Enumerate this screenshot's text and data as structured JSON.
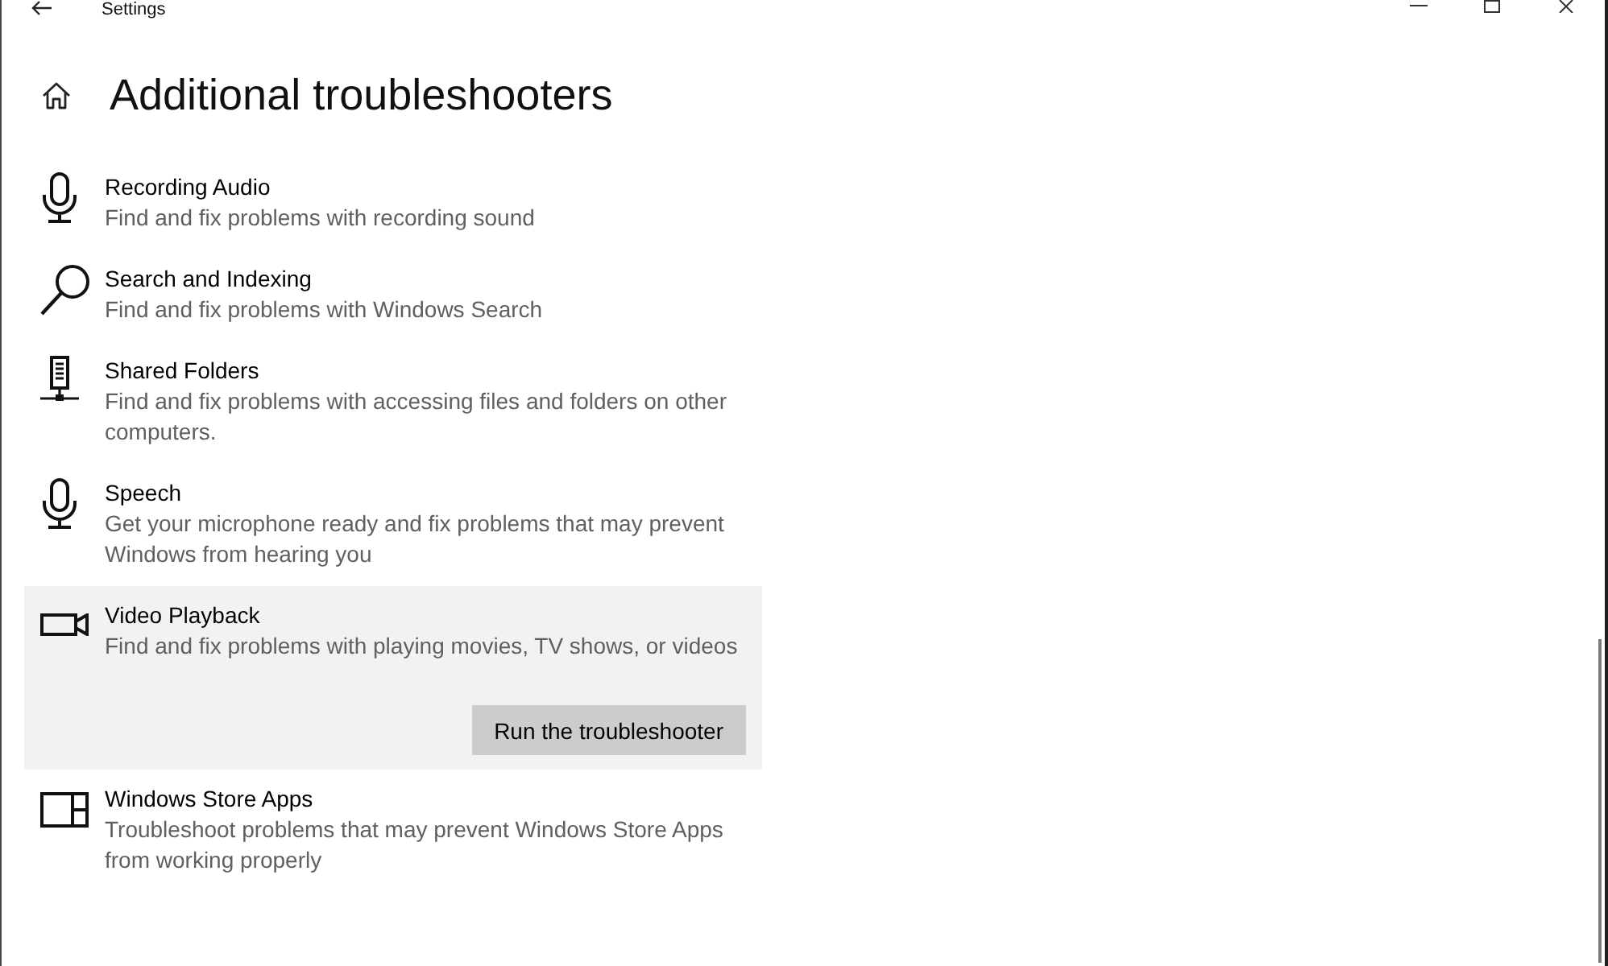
{
  "window": {
    "title": "Settings"
  },
  "page": {
    "title": "Additional troubleshooters"
  },
  "troubleshooters": [
    {
      "kind": "microphone",
      "title": "Recording Audio",
      "description": "Find and fix problems with recording sound",
      "selected": false
    },
    {
      "kind": "search",
      "title": "Search and Indexing",
      "description": "Find and fix problems with Windows Search",
      "selected": false
    },
    {
      "kind": "server",
      "title": "Shared Folders",
      "description": "Find and fix problems with accessing files and folders on other computers.",
      "selected": false
    },
    {
      "kind": "microphone",
      "title": "Speech",
      "description": "Get your microphone ready and fix problems that may prevent Windows from hearing you",
      "selected": false
    },
    {
      "kind": "camera",
      "title": "Video Playback",
      "description": "Find and fix problems with playing movies, TV shows, or videos",
      "selected": true,
      "action": "Run the troubleshooter"
    },
    {
      "kind": "apps",
      "title": "Windows Store Apps",
      "description": "Troubleshoot problems that may prevent Windows Store Apps from working properly",
      "selected": false
    }
  ]
}
